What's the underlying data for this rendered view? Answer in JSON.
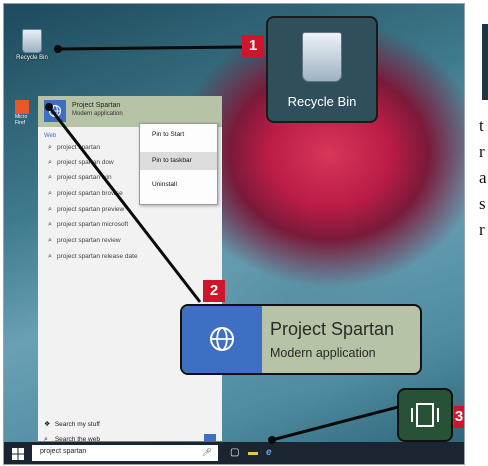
{
  "desktop": {
    "recycle_bin_label": "Recycle Bin",
    "side_app_label": "Micro Firef"
  },
  "start_menu": {
    "top_result": {
      "name": "Project Spartan",
      "subtitle": "Modern application"
    },
    "web_header": "Web",
    "suggestions": [
      "project spartan",
      "project spartan dow",
      "project spartan win",
      "project spartan browse",
      "project spartan preview",
      "project spartan microsoft",
      "project spartan review",
      "project spartan release date"
    ],
    "search_my_stuff": "Search my stuff",
    "search_the_web": "Search the web"
  },
  "context_menu": {
    "items": [
      "Pin to Start",
      "Pin to taskbar",
      "Uninstall"
    ],
    "highlighted": "Pin to taskbar"
  },
  "taskbar": {
    "search_text": "project spartan"
  },
  "callouts": {
    "one": "1",
    "two": "2",
    "three": "3",
    "big_label": "Recycle Bin",
    "spartan_name": "Project Spartan",
    "spartan_subtitle": "Modern application"
  },
  "text_column": [
    "t",
    "r",
    "a",
    "s",
    "r"
  ],
  "colors": {
    "accent_blue": "#3f6fc3",
    "highlight_green": "#b7c3a6",
    "callout_red": "#d0152b",
    "taskbar": "#1b2431"
  },
  "icons": [
    "recycle-bin-icon",
    "globe-icon",
    "search-icon",
    "windows-logo-icon",
    "task-view-icon",
    "file-explorer-icon",
    "edge-icon"
  ]
}
